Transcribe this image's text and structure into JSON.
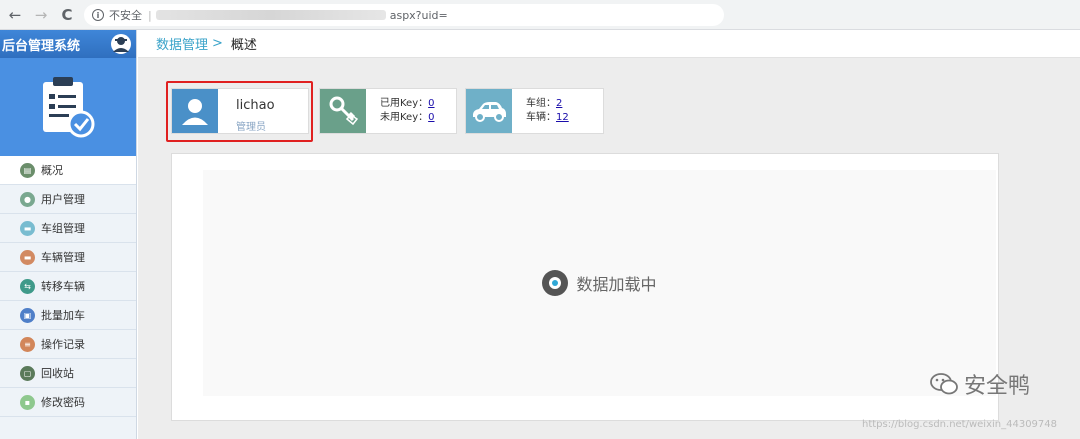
{
  "browser": {
    "back": "←",
    "forward": "→",
    "reload": "C",
    "security_label": "不安全",
    "url_tail": "aspx?uid="
  },
  "sidebar": {
    "title": "后台管理系统",
    "items": [
      {
        "label": "概况",
        "color": "#6b8e6b",
        "icon": "overview-icon"
      },
      {
        "label": "用户管理",
        "color": "#7aa890",
        "icon": "user-icon"
      },
      {
        "label": "车组管理",
        "color": "#79bcd0",
        "icon": "car-group-icon"
      },
      {
        "label": "车辆管理",
        "color": "#d28a62",
        "icon": "car-icon"
      },
      {
        "label": "转移车辆",
        "color": "#3f9a8a",
        "icon": "transfer-icon"
      },
      {
        "label": "批量加车",
        "color": "#4f7fc8",
        "icon": "batch-add-icon"
      },
      {
        "label": "操作记录",
        "color": "#d2865a",
        "icon": "log-icon"
      },
      {
        "label": "回收站",
        "color": "#5a7a5a",
        "icon": "recycle-icon"
      },
      {
        "label": "修改密码",
        "color": "#8ec88e",
        "icon": "lock-icon"
      }
    ]
  },
  "breadcrumb": {
    "parent": "数据管理",
    "separator": ">",
    "current": "概述"
  },
  "cards": {
    "user": {
      "name": "lichao",
      "role": "管理员",
      "color": "#4a90c8"
    },
    "keys": {
      "used_label": "已用Key：",
      "used_value": "0",
      "unused_label": "未用Key：",
      "unused_value": "0",
      "color": "#6aa08a"
    },
    "cars": {
      "groups_label": "车组：",
      "groups_value": "2",
      "vehicles_label": "车辆：",
      "vehicles_value": "12",
      "color": "#6fb0c8"
    }
  },
  "loading": {
    "text": "数据加载中"
  },
  "watermark": {
    "text": "安全鸭",
    "url": "https://blog.csdn.net/weixin_44309748"
  }
}
